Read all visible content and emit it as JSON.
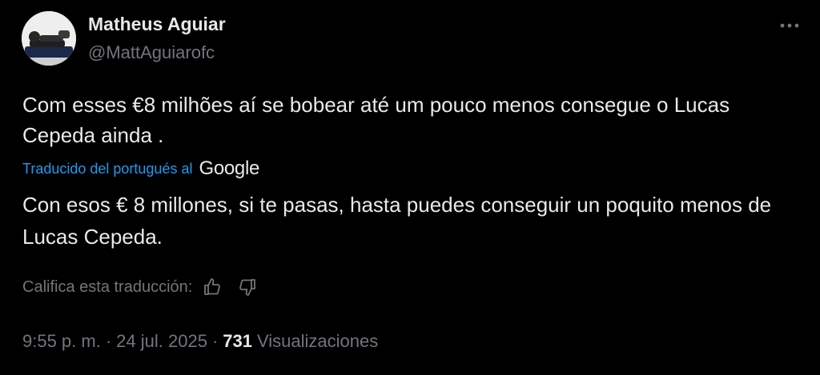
{
  "author": {
    "display_name": "Matheus Aguiar",
    "handle": "@MattAguiarofc",
    "avatar_icon": "profile-photo"
  },
  "tweet": {
    "text": "Com esses €8 milhões aí se bobear até um pouco menos consegue o Lucas Cepeda ainda .",
    "translation_label": "Traducido del portugués al",
    "translation_provider": "Google",
    "translated_text": "Con esos € 8 millones, si te pasas, hasta puedes conseguir un poquito menos de Lucas Cepeda.",
    "rate_label": "Califica esta traducción:",
    "time": "9:55 p. m.",
    "separator": "·",
    "date": "24 jul. 2025",
    "views_count": "731",
    "views_label": "Visualizaciones"
  },
  "colors": {
    "background": "#000000",
    "primary_text": "#e7e9ea",
    "secondary_text": "#71767b",
    "link": "#1d9bf0"
  },
  "icons": {
    "more": "more-dots-icon",
    "thumbs_up": "thumbs-up-icon",
    "thumbs_down": "thumbs-down-icon"
  }
}
